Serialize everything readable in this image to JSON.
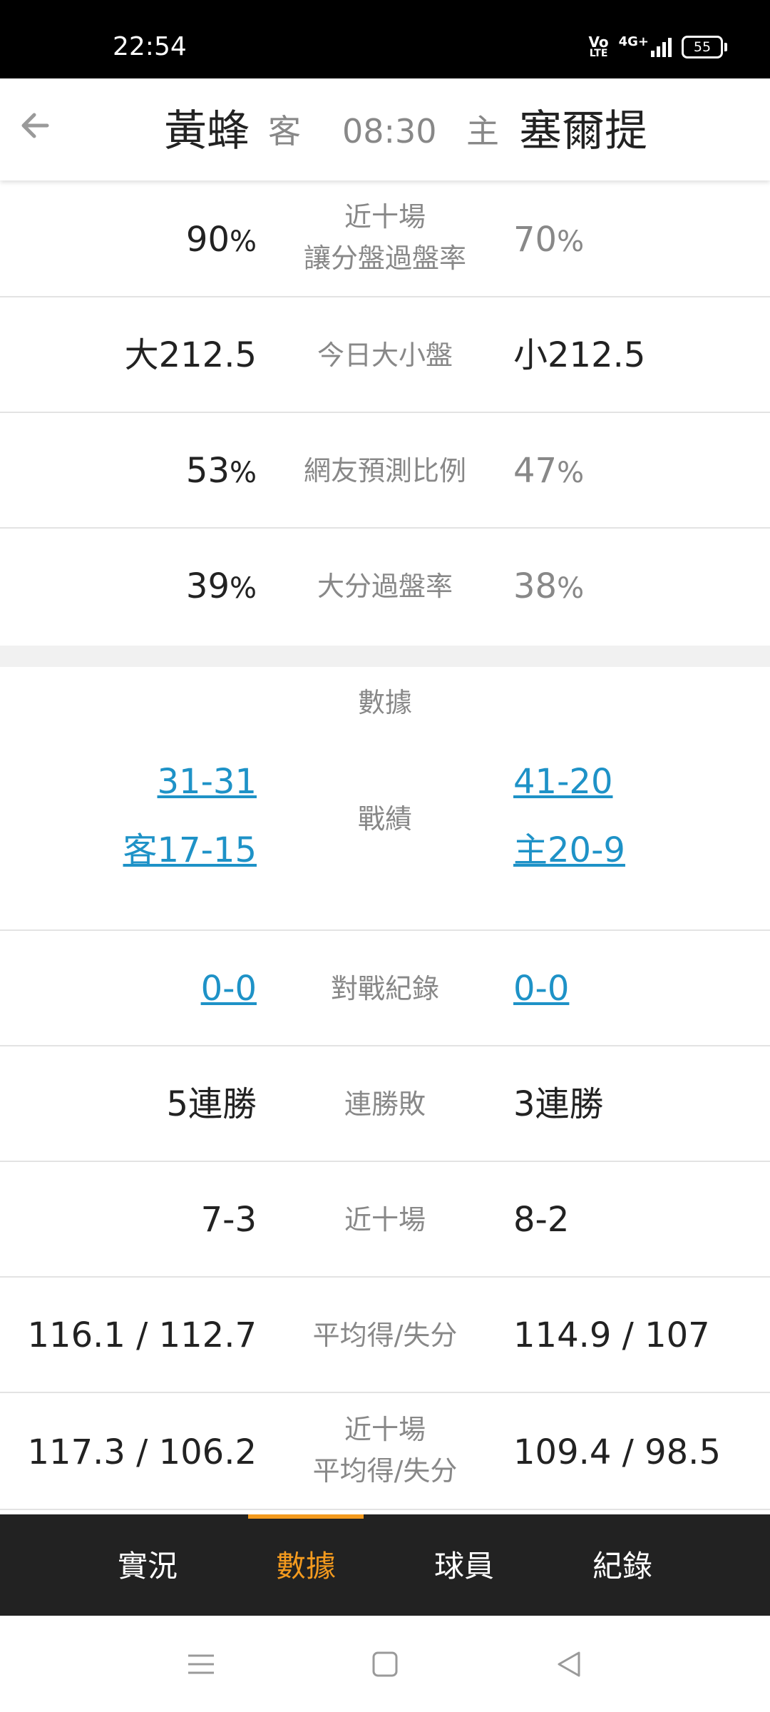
{
  "status_bar": {
    "time": "22:54",
    "volte_top": "Vo",
    "volte_bottom": "LTE",
    "network": "4G+",
    "battery": "55"
  },
  "header": {
    "away_team": "黃蜂",
    "away_tag": "客",
    "match_time": "08:30",
    "home_tag": "主",
    "home_team": "塞爾提"
  },
  "rows": {
    "spread_rate": {
      "away": "90",
      "label_line1": "近十場",
      "label_line2": "讓分盤過盤率",
      "home": "70",
      "unit": "%"
    },
    "total_line": {
      "away": "大212.5",
      "label": "今日大小盤",
      "home": "小212.5"
    },
    "prediction": {
      "away": "53",
      "label": "網友預測比例",
      "home": "47",
      "unit": "%"
    },
    "over_rate": {
      "away": "39",
      "label": "大分過盤率",
      "home": "38",
      "unit": "%"
    }
  },
  "stats": {
    "section_title": "數據",
    "record": {
      "away_overall": "31-31",
      "away_split": "客17-15",
      "label": "戰績",
      "home_overall": "41-20",
      "home_split": "主20-9"
    },
    "head_to_head": {
      "away": "0-0",
      "label": "對戰紀錄",
      "home": "0-0"
    },
    "streak": {
      "away": "5連勝",
      "label": "連勝敗",
      "home": "3連勝"
    },
    "last_ten": {
      "away": "7-3",
      "label": "近十場",
      "home": "8-2"
    },
    "avg_points": {
      "away": "116.1 / 112.7",
      "label": "平均得/失分",
      "home": "114.9 / 107"
    },
    "last_ten_avg": {
      "away": "117.3 / 106.2",
      "label_line1": "近十場",
      "label_line2": "平均得/失分",
      "home": "109.4 / 98.5"
    }
  },
  "tabs": [
    {
      "label": "實況"
    },
    {
      "label": "數據"
    },
    {
      "label": "球員"
    },
    {
      "label": "紀錄"
    }
  ],
  "colors": {
    "accent": "#f39a1e",
    "link": "#1e92c7",
    "tabbar_bg": "#222222"
  }
}
